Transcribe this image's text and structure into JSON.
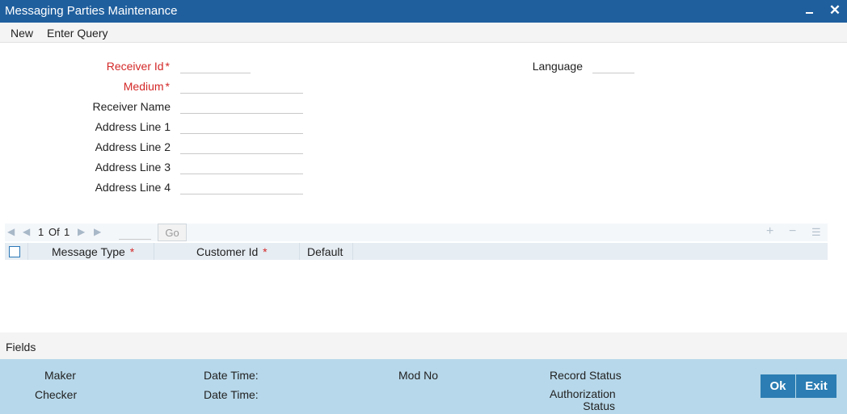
{
  "window": {
    "title": "Messaging Parties Maintenance",
    "minimize_glyph": "",
    "close_glyph": "✕"
  },
  "menu": {
    "new": "New",
    "enter_query": "Enter Query"
  },
  "form": {
    "receiver_id": {
      "label": "Receiver Id",
      "value": ""
    },
    "medium": {
      "label": "Medium",
      "value": ""
    },
    "receiver_name": {
      "label": "Receiver Name",
      "value": ""
    },
    "address_line_1": {
      "label": "Address Line 1",
      "value": ""
    },
    "address_line_2": {
      "label": "Address Line 2",
      "value": ""
    },
    "address_line_3": {
      "label": "Address Line 3",
      "value": ""
    },
    "address_line_4": {
      "label": "Address Line 4",
      "value": ""
    },
    "language": {
      "label": "Language",
      "value": ""
    },
    "required_mark": "*"
  },
  "grid": {
    "pager": {
      "current": "1",
      "of_label": "Of",
      "total": "1",
      "go_label": "Go"
    },
    "columns": {
      "message_type": "Message Type",
      "customer_id": "Customer Id",
      "default": "Default"
    },
    "required_mark": "*",
    "rows": []
  },
  "fields_section": {
    "label": "Fields"
  },
  "audit": {
    "maker": "Maker",
    "checker": "Checker",
    "date_time_1": "Date Time:",
    "date_time_2": "Date Time:",
    "mod_no": "Mod No",
    "record_status": "Record Status",
    "authorization_status_line1": "Authorization",
    "authorization_status_line2": "Status"
  },
  "buttons": {
    "ok": "Ok",
    "exit": "Exit"
  },
  "colors": {
    "title_bar": "#1f5f9e",
    "footer": "#b7d8ea",
    "required": "#d42828",
    "button": "#2b7db3"
  },
  "icons": [
    "minimize-icon",
    "close-icon",
    "first-page-icon",
    "prev-page-icon",
    "next-page-icon",
    "last-page-icon",
    "add-row-icon",
    "delete-row-icon",
    "single-view-icon"
  ]
}
